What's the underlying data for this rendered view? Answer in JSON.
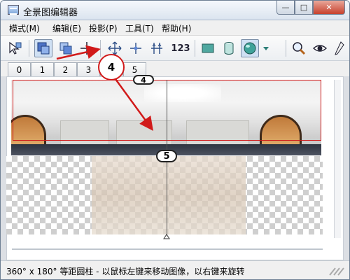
{
  "window": {
    "title": "全景图编辑器",
    "minimize_label": "—",
    "maximize_label": "□",
    "close_label": "✕"
  },
  "menu": {
    "items": [
      {
        "label": "模式(M)"
      },
      {
        "label": "编辑(E)"
      },
      {
        "label": "投影(P)"
      },
      {
        "label": "工具(T)"
      },
      {
        "label": "帮助(H)"
      }
    ]
  },
  "toolbar": {
    "tools": [
      {
        "name": "select-tool-icon"
      },
      {
        "name": "image-layer-icon",
        "active": true
      },
      {
        "name": "copy-layer-icon"
      },
      {
        "name": "crosshair-icon"
      },
      {
        "name": "fit-all-icon"
      },
      {
        "name": "move-center-icon"
      },
      {
        "name": "align-vertical-icon"
      },
      {
        "name": "number-123",
        "label": "123"
      },
      {
        "name": "plane-projection-icon"
      },
      {
        "name": "cylinder-projection-icon"
      },
      {
        "name": "sphere-projection-icon",
        "active": true
      },
      {
        "name": "dropdown-arrow-icon"
      },
      {
        "name": "zoom-icon"
      },
      {
        "name": "preview-eye-icon"
      },
      {
        "name": "pen-icon"
      }
    ]
  },
  "tabs": {
    "items": [
      {
        "label": "0"
      },
      {
        "label": "1"
      },
      {
        "label": "2"
      },
      {
        "label": "3"
      },
      {
        "label": "4"
      },
      {
        "label": "5"
      }
    ],
    "selected_index": 4
  },
  "canvas": {
    "marker_top_label": "4",
    "marker_five_label": "5",
    "callout_label": "4"
  },
  "status": {
    "text": "360° x 180° 等距圆柱 - 以鼠标左键来移动图像，以右键来旋转"
  },
  "colors": {
    "annotation_red": "#d11a1a",
    "active_tool_bg": "#cfe0f3"
  }
}
